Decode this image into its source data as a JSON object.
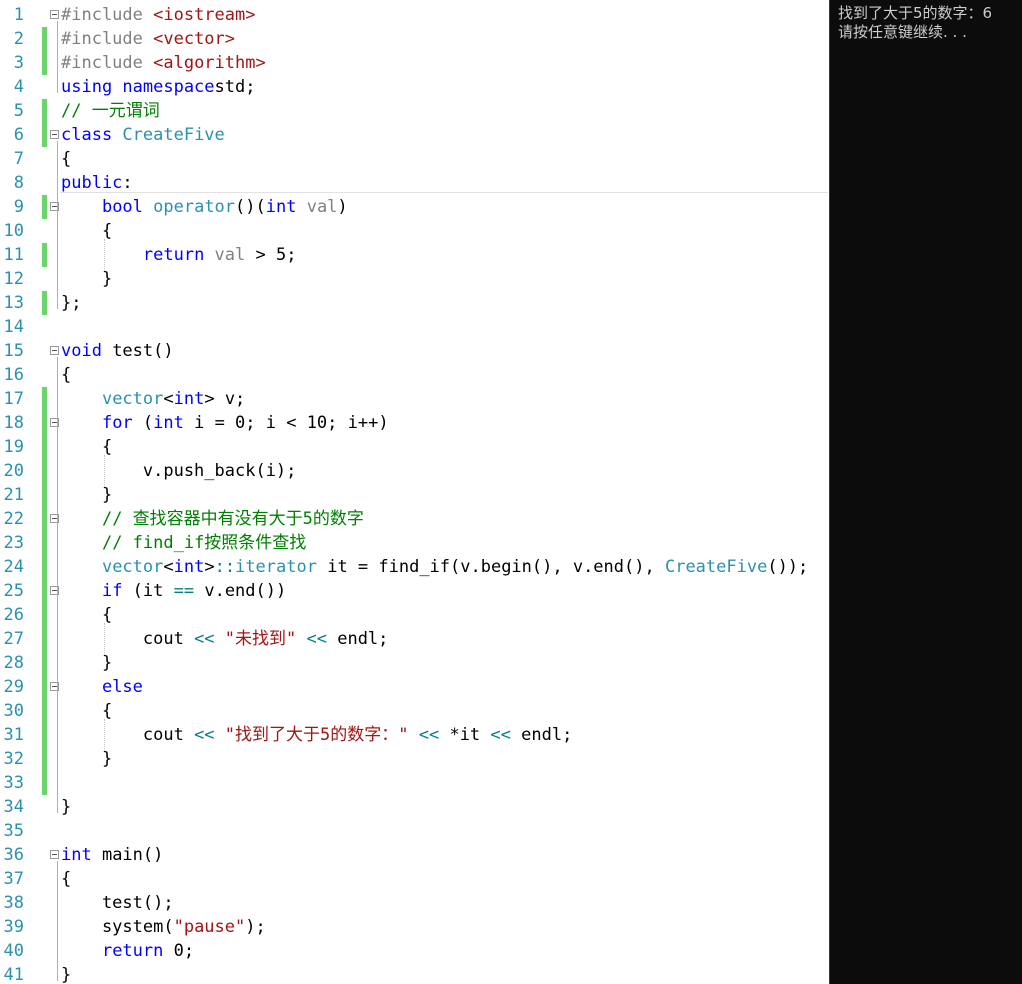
{
  "editor": {
    "lines": [
      {
        "n": "1",
        "chg": false,
        "fold": true,
        "t": [
          [
            "pp",
            "#include "
          ],
          [
            "str",
            "<iostream>"
          ]
        ]
      },
      {
        "n": "2",
        "chg": true,
        "fold": false,
        "t": [
          [
            "pp",
            "#include "
          ],
          [
            "str",
            "<vector>"
          ]
        ]
      },
      {
        "n": "3",
        "chg": true,
        "fold": false,
        "t": [
          [
            "pp",
            "#include "
          ],
          [
            "str",
            "<algorithm>"
          ]
        ]
      },
      {
        "n": "4",
        "chg": false,
        "fold": false,
        "t": [
          [
            "kw",
            "using namespace"
          ],
          [
            "",
            "std;"
          ]
        ]
      },
      {
        "n": "5",
        "chg": true,
        "fold": false,
        "t": [
          [
            "cm",
            "// 一元谓词"
          ]
        ]
      },
      {
        "n": "6",
        "chg": true,
        "fold": true,
        "t": [
          [
            "kw",
            "class "
          ],
          [
            "ty",
            "CreateFive"
          ]
        ]
      },
      {
        "n": "7",
        "chg": false,
        "fold": false,
        "t": [
          [
            "",
            "{"
          ]
        ]
      },
      {
        "n": "8",
        "chg": false,
        "fold": false,
        "t": [
          [
            "kw",
            "public"
          ],
          [
            "",
            ":"
          ]
        ]
      },
      {
        "n": "9",
        "chg": true,
        "fold": true,
        "t": [
          [
            "",
            "    "
          ],
          [
            "kw",
            "bool "
          ],
          [
            "ty",
            "operator"
          ],
          [
            "",
            "()("
          ],
          [
            "kw",
            "int "
          ],
          [
            "pm",
            "val"
          ],
          [
            "",
            ")"
          ]
        ]
      },
      {
        "n": "10",
        "chg": false,
        "fold": false,
        "t": [
          [
            "",
            "    {"
          ]
        ]
      },
      {
        "n": "11",
        "chg": true,
        "fold": false,
        "t": [
          [
            "",
            "        "
          ],
          [
            "kw",
            "return "
          ],
          [
            "pm",
            "val"
          ],
          [
            "",
            " > 5;"
          ]
        ]
      },
      {
        "n": "12",
        "chg": false,
        "fold": false,
        "t": [
          [
            "",
            "    }"
          ]
        ]
      },
      {
        "n": "13",
        "chg": true,
        "fold": false,
        "t": [
          [
            "",
            "};"
          ]
        ]
      },
      {
        "n": "14",
        "chg": false,
        "fold": false,
        "t": []
      },
      {
        "n": "15",
        "chg": false,
        "fold": true,
        "t": [
          [
            "kw",
            "void "
          ],
          [
            "",
            "test()"
          ]
        ]
      },
      {
        "n": "16",
        "chg": false,
        "fold": false,
        "t": [
          [
            "",
            "{"
          ]
        ]
      },
      {
        "n": "17",
        "chg": true,
        "fold": false,
        "t": [
          [
            "",
            "    "
          ],
          [
            "ty",
            "vector"
          ],
          [
            "",
            "<"
          ],
          [
            "kw",
            "int"
          ],
          [
            "",
            "> v;"
          ]
        ]
      },
      {
        "n": "18",
        "chg": true,
        "fold": true,
        "t": [
          [
            "",
            "    "
          ],
          [
            "kw",
            "for "
          ],
          [
            "",
            "("
          ],
          [
            "kw",
            "int "
          ],
          [
            "",
            "i = 0; i < 10; i++)"
          ]
        ]
      },
      {
        "n": "19",
        "chg": true,
        "fold": false,
        "t": [
          [
            "",
            "    {"
          ]
        ]
      },
      {
        "n": "20",
        "chg": true,
        "fold": false,
        "t": [
          [
            "",
            "        v.push_back(i);"
          ]
        ]
      },
      {
        "n": "21",
        "chg": true,
        "fold": false,
        "t": [
          [
            "",
            "    }"
          ]
        ]
      },
      {
        "n": "22",
        "chg": true,
        "fold": true,
        "t": [
          [
            "",
            "    "
          ],
          [
            "cm",
            "// 查找容器中有没有大于5的数字"
          ]
        ]
      },
      {
        "n": "23",
        "chg": true,
        "fold": false,
        "t": [
          [
            "",
            "    "
          ],
          [
            "cm",
            "// find_if按照条件查找"
          ]
        ]
      },
      {
        "n": "24",
        "chg": true,
        "fold": false,
        "t": [
          [
            "",
            "    "
          ],
          [
            "ty",
            "vector"
          ],
          [
            "",
            "<"
          ],
          [
            "kw",
            "int"
          ],
          [
            "",
            ">"
          ],
          [
            "op",
            "::"
          ],
          [
            "ty",
            "iterator"
          ],
          [
            "",
            " it = find_if(v.begin(), v.end(), "
          ],
          [
            "ty",
            "CreateFive"
          ],
          [
            "",
            "());"
          ]
        ]
      },
      {
        "n": "25",
        "chg": true,
        "fold": true,
        "t": [
          [
            "",
            "    "
          ],
          [
            "kw",
            "if "
          ],
          [
            "",
            "(it "
          ],
          [
            "op",
            "=="
          ],
          [
            "",
            " v.end())"
          ]
        ]
      },
      {
        "n": "26",
        "chg": true,
        "fold": false,
        "t": [
          [
            "",
            "    {"
          ]
        ]
      },
      {
        "n": "27",
        "chg": true,
        "fold": false,
        "t": [
          [
            "",
            "        cout "
          ],
          [
            "op",
            "<<"
          ],
          [
            "str",
            " \"未找到\" "
          ],
          [
            "op",
            "<<"
          ],
          [
            "",
            " endl;"
          ]
        ]
      },
      {
        "n": "28",
        "chg": true,
        "fold": false,
        "t": [
          [
            "",
            "    }"
          ]
        ]
      },
      {
        "n": "29",
        "chg": true,
        "fold": true,
        "t": [
          [
            "",
            "    "
          ],
          [
            "kw",
            "else"
          ]
        ]
      },
      {
        "n": "30",
        "chg": true,
        "fold": false,
        "t": [
          [
            "",
            "    {"
          ]
        ]
      },
      {
        "n": "31",
        "chg": true,
        "fold": false,
        "t": [
          [
            "",
            "        cout "
          ],
          [
            "op",
            "<<"
          ],
          [
            "str",
            " \"找到了大于5的数字：\" "
          ],
          [
            "op",
            "<<"
          ],
          [
            "",
            " *it "
          ],
          [
            "op",
            "<<"
          ],
          [
            "",
            " endl;"
          ]
        ]
      },
      {
        "n": "32",
        "chg": true,
        "fold": false,
        "t": [
          [
            "",
            "    }"
          ]
        ]
      },
      {
        "n": "33",
        "chg": true,
        "fold": false,
        "t": []
      },
      {
        "n": "34",
        "chg": false,
        "fold": false,
        "t": [
          [
            "",
            "}"
          ]
        ]
      },
      {
        "n": "35",
        "chg": false,
        "fold": false,
        "t": []
      },
      {
        "n": "36",
        "chg": false,
        "fold": true,
        "t": [
          [
            "kw",
            "int "
          ],
          [
            "",
            "main()"
          ]
        ]
      },
      {
        "n": "37",
        "chg": false,
        "fold": false,
        "t": [
          [
            "",
            "{"
          ]
        ]
      },
      {
        "n": "38",
        "chg": false,
        "fold": false,
        "t": [
          [
            "",
            "    test();"
          ]
        ]
      },
      {
        "n": "39",
        "chg": false,
        "fold": false,
        "t": [
          [
            "",
            "    system("
          ],
          [
            "str",
            "\"pause\""
          ],
          [
            "",
            ");"
          ]
        ]
      },
      {
        "n": "40",
        "chg": false,
        "fold": false,
        "t": [
          [
            "",
            "    "
          ],
          [
            "kw",
            "return "
          ],
          [
            "",
            "0;"
          ]
        ]
      },
      {
        "n": "41",
        "chg": false,
        "fold": false,
        "t": [
          [
            "",
            "}"
          ]
        ]
      }
    ]
  },
  "console": {
    "output_line1": "找到了大于5的数字：6",
    "output_line2": "请按任意键继续. . ."
  },
  "colors": {
    "keyword": "#0000ff",
    "type": "#2b91af",
    "string": "#a31515",
    "comment": "#008000",
    "change_marker": "#6dd36d",
    "console_bg": "#0c0c0c"
  }
}
